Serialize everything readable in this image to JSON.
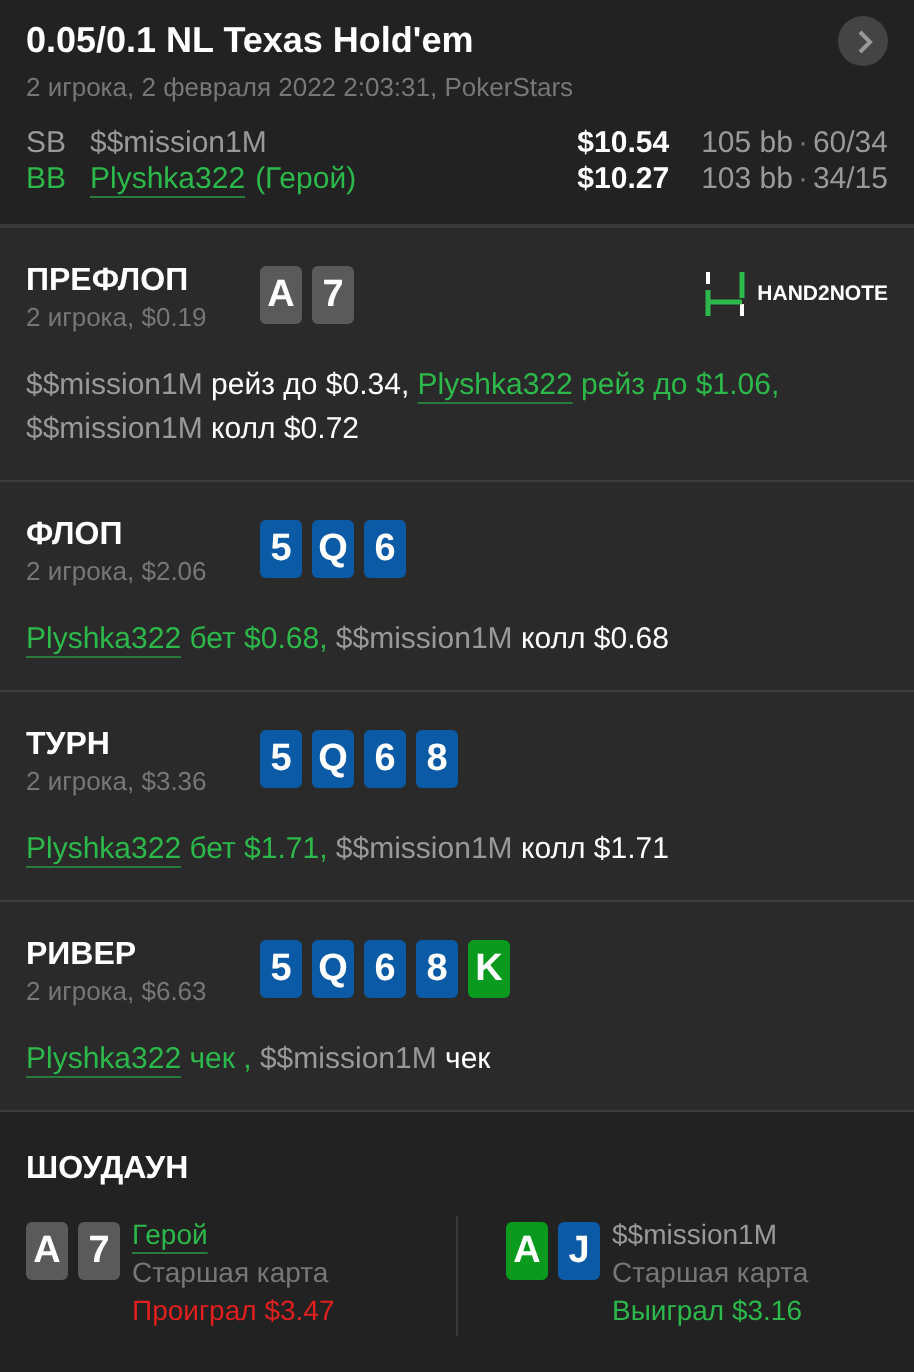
{
  "header": {
    "title": "0.05/0.1 NL Texas Hold'em",
    "subtitle": "2 игрока, 2 февраля 2022 2:03:31, PokerStars",
    "players": [
      {
        "position": "SB",
        "name": "$$mission1M",
        "hero": false,
        "stack": "$10.54",
        "bb": "105 bb",
        "separator": "·",
        "stats": "60/34"
      },
      {
        "position": "BB",
        "name": "Plyshka322",
        "hero": true,
        "hero_label": "(Герой)",
        "stack": "$10.27",
        "bb": "103 bb",
        "separator": "·",
        "stats": "34/15"
      }
    ]
  },
  "streets": [
    {
      "name": "ПРЕФЛОП",
      "info": "2 игрока, $0.19",
      "logo": "HAND2NOTE",
      "cards": [
        {
          "rank": "A",
          "color": "#5a5a5a"
        },
        {
          "rank": "7",
          "color": "#5a5a5a"
        }
      ],
      "actions": [
        {
          "player": "$$mission1M",
          "action": "рейз до $0.34,",
          "hero": false
        },
        {
          "player": "Plyshka322",
          "action": "рейз до $1.06,",
          "hero": true
        },
        {
          "player": "$$mission1M",
          "action": "колл $0.72",
          "hero": false
        }
      ]
    },
    {
      "name": "ФЛОП",
      "info": "2 игрока, $2.06",
      "cards": [
        {
          "rank": "5",
          "color": "#0b5aa6"
        },
        {
          "rank": "Q",
          "color": "#0b5aa6"
        },
        {
          "rank": "6",
          "color": "#0b5aa6"
        }
      ],
      "actions": [
        {
          "player": "Plyshka322",
          "action": "бет $0.68,",
          "hero": true
        },
        {
          "player": "$$mission1M",
          "action": "колл $0.68",
          "hero": false
        }
      ]
    },
    {
      "name": "ТУРН",
      "info": "2 игрока, $3.36",
      "cards": [
        {
          "rank": "5",
          "color": "#0b5aa6"
        },
        {
          "rank": "Q",
          "color": "#0b5aa6"
        },
        {
          "rank": "6",
          "color": "#0b5aa6"
        },
        {
          "rank": "8",
          "color": "#0b5aa6"
        }
      ],
      "actions": [
        {
          "player": "Plyshka322",
          "action": "бет $1.71,",
          "hero": true
        },
        {
          "player": "$$mission1M",
          "action": "колл $1.71",
          "hero": false
        }
      ]
    },
    {
      "name": "РИВЕР",
      "info": "2 игрока, $6.63",
      "cards": [
        {
          "rank": "5",
          "color": "#0b5aa6"
        },
        {
          "rank": "Q",
          "color": "#0b5aa6"
        },
        {
          "rank": "6",
          "color": "#0b5aa6"
        },
        {
          "rank": "8",
          "color": "#0b5aa6"
        },
        {
          "rank": "K",
          "color": "#0a9a1e"
        }
      ],
      "actions": [
        {
          "player": "Plyshka322",
          "action": "чек ,",
          "hero": true
        },
        {
          "player": "$$mission1M",
          "action": "чек",
          "hero": false
        }
      ]
    }
  ],
  "showdown": {
    "title": "ШОУДАУН",
    "players": [
      {
        "name": "Герой",
        "hero": true,
        "hand": "Старшая карта",
        "result": "Проиграл $3.47",
        "won": false,
        "cards": [
          {
            "rank": "A",
            "color": "#5a5a5a"
          },
          {
            "rank": "7",
            "color": "#5a5a5a"
          }
        ]
      },
      {
        "name": "$$mission1M",
        "hero": false,
        "hand": "Старшая карта",
        "result": "Выиграл $3.16",
        "won": true,
        "cards": [
          {
            "rank": "A",
            "color": "#0a9a1e"
          },
          {
            "rank": "J",
            "color": "#0b5aa6"
          }
        ]
      }
    ]
  }
}
